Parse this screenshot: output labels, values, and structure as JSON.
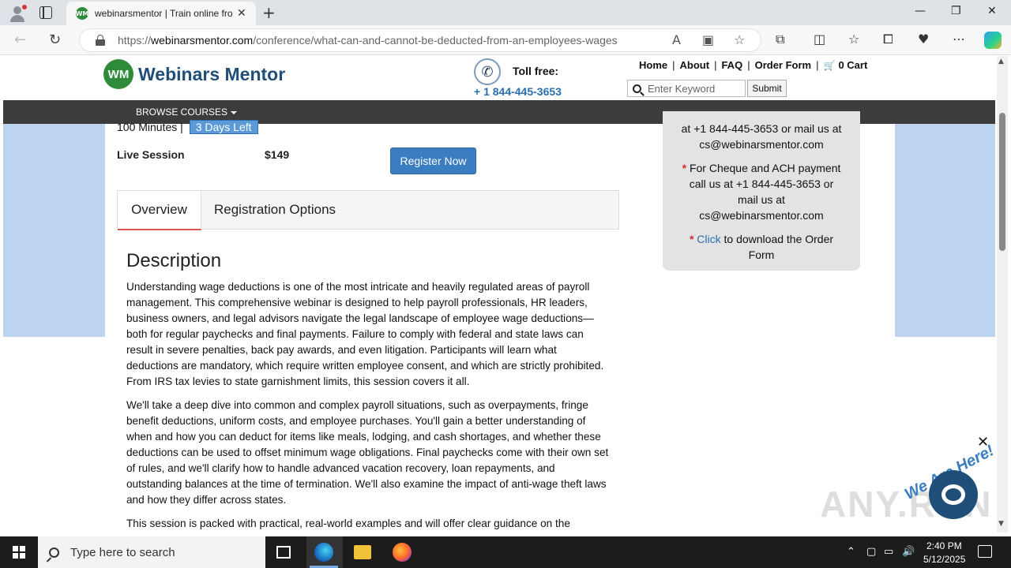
{
  "browser": {
    "tab_title": "webinarsmentor | Train online fro",
    "tab_favicon": "WM",
    "url_prefix": "https://",
    "url_domain": "webinarsmentor.com",
    "url_path": "/conference/what-can-and-cannot-be-deducted-from-an-employees-wages"
  },
  "header": {
    "logo_mark": "WM",
    "logo_text": "Webinars Mentor",
    "tollfree_label": "Toll free:",
    "tollfree_number": "+ 1 844-445-3653",
    "nav": {
      "home": "Home",
      "about": "About",
      "faq": "FAQ",
      "order_form": "Order Form",
      "cart": "0 Cart"
    },
    "search_placeholder": "Enter Keyword",
    "submit_label": "Submit",
    "browse_courses": "BROWSE COURSES"
  },
  "course": {
    "duration": "100 Minutes",
    "days_left": "3 Days Left",
    "session_label": "Live Session",
    "price": "$149",
    "register_label": "Register Now"
  },
  "tabs": {
    "overview": "Overview",
    "registration": "Registration Options"
  },
  "description": {
    "title": "Description",
    "p1": "Understanding wage deductions is one of the most intricate and heavily regulated areas of payroll management. This comprehensive webinar is designed to help payroll professionals, HR leaders, business owners, and legal advisors navigate the legal landscape of employee wage deductions—both for regular paychecks and final payments. Failure to comply with federal and state laws can result in severe penalties, back pay awards, and even litigation. Participants will learn what deductions are mandatory, which require written employee consent, and which are strictly prohibited. From IRS tax levies to state garnishment limits, this session covers it all.",
    "p2": "We'll take a deep dive into common and complex payroll situations, such as overpayments, fringe benefit deductions, uniform costs, and employee purchases. You'll gain a better understanding of when and how you can deduct for items like meals, lodging, and cash shortages, and whether these deductions can be used to offset minimum wage obligations. Final paychecks come with their own set of rules, and we'll clarify how to handle advanced vacation recovery, loan repayments, and outstanding balances at the time of termination. We'll also examine the impact of anti-wage theft laws and how they differ across states.",
    "p3": "This session is packed with practical, real-world examples and will offer clear guidance on the"
  },
  "sidebar": {
    "line1": "at +1 844-445-3653 or mail us at",
    "line2": "cs@webinarsmentor.com",
    "cheque_a": "For Cheque and ACH payment",
    "cheque_b": "call us at +1 844-445-3653 or",
    "cheque_c": "mail us at",
    "cheque_d": "cs@webinarsmentor.com",
    "star": "*",
    "click": "Click",
    "order_a": " to download the Order",
    "order_b": "Form"
  },
  "overlay": {
    "chat_tagline": "We Are Here!",
    "watermark": "ANY.RUN"
  },
  "taskbar": {
    "search_text": "Type here to search",
    "time": "2:40 PM",
    "date": "5/12/2025"
  }
}
